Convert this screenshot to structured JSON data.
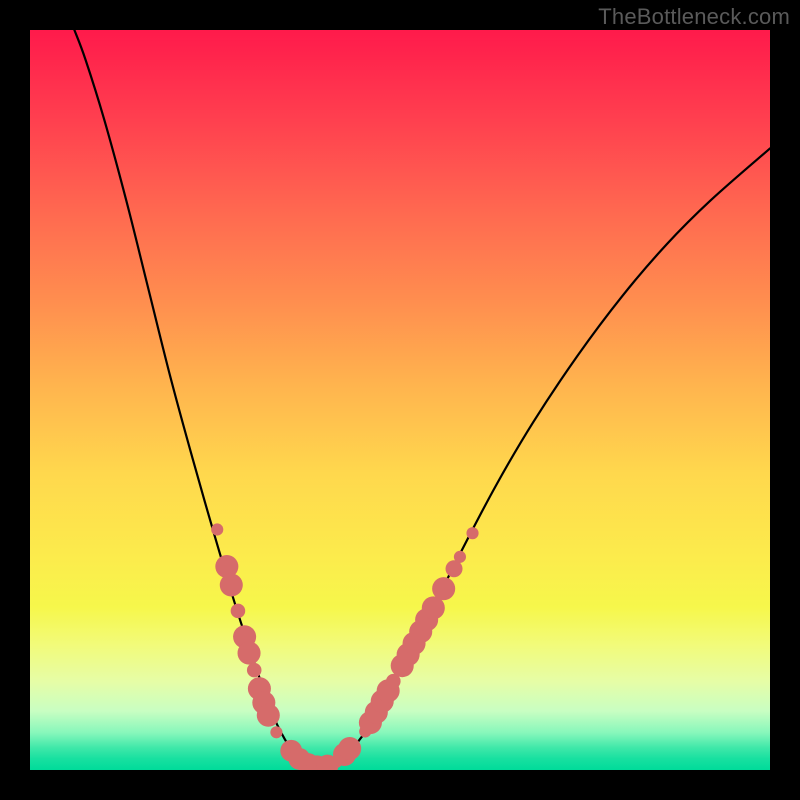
{
  "watermark": "TheBottleneck.com",
  "colors": {
    "frame_bg": "#000000",
    "marker_fill": "#d66b6a",
    "curve_stroke": "#000000",
    "gradient_stops": [
      "#ff1a4b",
      "#ff3f4f",
      "#ff6a50",
      "#ff8f4f",
      "#ffb44e",
      "#ffd84d",
      "#fceb4c",
      "#f6f74b",
      "#f2fb79",
      "#e6fda6",
      "#c9fec2",
      "#86f7bb",
      "#3fe8a9",
      "#17e0a0",
      "#00db9a"
    ]
  },
  "chart_data": {
    "type": "line",
    "title": "",
    "xlabel": "",
    "ylabel": "",
    "xlim": [
      0,
      100
    ],
    "ylim": [
      0,
      100
    ],
    "curve_points": [
      {
        "x": 6.0,
        "y": 100.0
      },
      {
        "x": 7.5,
        "y": 96.0
      },
      {
        "x": 10.0,
        "y": 88.0
      },
      {
        "x": 13.0,
        "y": 77.0
      },
      {
        "x": 16.0,
        "y": 65.0
      },
      {
        "x": 19.0,
        "y": 53.0
      },
      {
        "x": 22.0,
        "y": 42.0
      },
      {
        "x": 25.0,
        "y": 31.5
      },
      {
        "x": 28.0,
        "y": 21.5
      },
      {
        "x": 31.0,
        "y": 12.5
      },
      {
        "x": 33.0,
        "y": 7.0
      },
      {
        "x": 35.0,
        "y": 3.2
      },
      {
        "x": 36.5,
        "y": 1.3
      },
      {
        "x": 38.0,
        "y": 0.5
      },
      {
        "x": 40.0,
        "y": 0.5
      },
      {
        "x": 42.0,
        "y": 1.3
      },
      {
        "x": 44.0,
        "y": 3.4
      },
      {
        "x": 46.0,
        "y": 6.2
      },
      {
        "x": 49.0,
        "y": 11.5
      },
      {
        "x": 53.0,
        "y": 19.0
      },
      {
        "x": 58.0,
        "y": 29.0
      },
      {
        "x": 63.0,
        "y": 38.5
      },
      {
        "x": 68.0,
        "y": 47.0
      },
      {
        "x": 74.0,
        "y": 56.0
      },
      {
        "x": 80.0,
        "y": 64.0
      },
      {
        "x": 86.0,
        "y": 71.0
      },
      {
        "x": 92.0,
        "y": 77.0
      },
      {
        "x": 100.0,
        "y": 84.0
      }
    ],
    "series": [
      {
        "name": "markers-left",
        "points": [
          {
            "x": 25.3,
            "y": 32.5,
            "r": 1.0
          },
          {
            "x": 26.6,
            "y": 27.5,
            "r": 1.9
          },
          {
            "x": 27.2,
            "y": 25.0,
            "r": 1.9
          },
          {
            "x": 28.1,
            "y": 21.5,
            "r": 1.2
          },
          {
            "x": 29.0,
            "y": 18.0,
            "r": 1.9
          },
          {
            "x": 29.6,
            "y": 15.8,
            "r": 1.9
          },
          {
            "x": 30.3,
            "y": 13.5,
            "r": 1.2
          },
          {
            "x": 31.0,
            "y": 11.0,
            "r": 1.9
          },
          {
            "x": 31.6,
            "y": 9.1,
            "r": 1.9
          },
          {
            "x": 32.2,
            "y": 7.4,
            "r": 1.9
          },
          {
            "x": 33.3,
            "y": 5.1,
            "r": 1.0
          }
        ]
      },
      {
        "name": "markers-bottom",
        "points": [
          {
            "x": 35.3,
            "y": 2.6,
            "r": 1.8
          },
          {
            "x": 36.4,
            "y": 1.5,
            "r": 1.8
          },
          {
            "x": 37.6,
            "y": 0.8,
            "r": 1.8
          },
          {
            "x": 38.8,
            "y": 0.5,
            "r": 1.8
          },
          {
            "x": 40.2,
            "y": 0.6,
            "r": 1.8
          },
          {
            "x": 41.4,
            "y": 1.1,
            "r": 1.0
          },
          {
            "x": 42.5,
            "y": 2.1,
            "r": 1.9
          },
          {
            "x": 43.2,
            "y": 2.9,
            "r": 1.9
          }
        ]
      },
      {
        "name": "markers-right",
        "points": [
          {
            "x": 45.3,
            "y": 5.2,
            "r": 1.0
          },
          {
            "x": 46.0,
            "y": 6.4,
            "r": 1.9
          },
          {
            "x": 46.8,
            "y": 7.8,
            "r": 1.9
          },
          {
            "x": 47.6,
            "y": 9.3,
            "r": 1.9
          },
          {
            "x": 48.4,
            "y": 10.7,
            "r": 1.9
          },
          {
            "x": 49.1,
            "y": 12.0,
            "r": 1.2
          },
          {
            "x": 50.3,
            "y": 14.1,
            "r": 1.9
          },
          {
            "x": 51.1,
            "y": 15.6,
            "r": 1.9
          },
          {
            "x": 51.9,
            "y": 17.1,
            "r": 1.9
          },
          {
            "x": 52.8,
            "y": 18.7,
            "r": 1.9
          },
          {
            "x": 53.6,
            "y": 20.3,
            "r": 1.9
          },
          {
            "x": 54.5,
            "y": 21.9,
            "r": 1.9
          },
          {
            "x": 55.9,
            "y": 24.5,
            "r": 1.9
          },
          {
            "x": 57.3,
            "y": 27.2,
            "r": 1.4
          },
          {
            "x": 58.1,
            "y": 28.8,
            "r": 1.0
          },
          {
            "x": 59.8,
            "y": 32.0,
            "r": 1.0
          }
        ]
      }
    ]
  }
}
